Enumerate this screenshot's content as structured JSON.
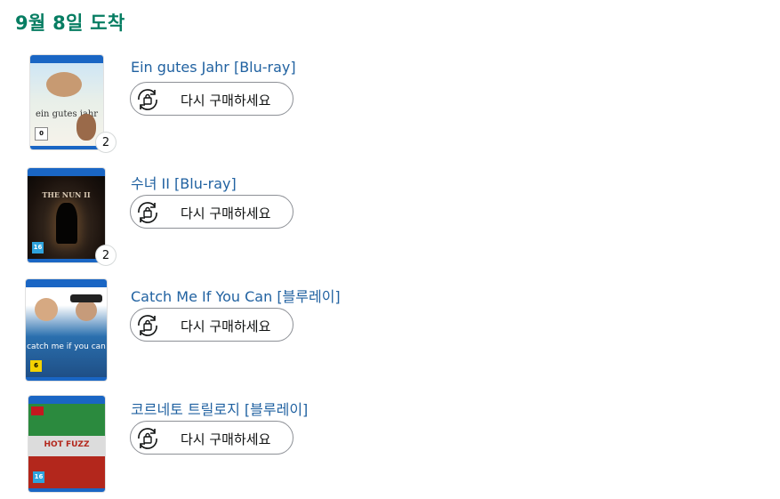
{
  "heading": "9월 8일 도착",
  "reorder_label": "다시 구매하세요",
  "items": [
    {
      "title": "Ein gutes Jahr [Blu-ray]",
      "quantity": "2",
      "cover_text": "ein gutes jahr",
      "age_rating": "0"
    },
    {
      "title": "수녀 II [Blu-ray]",
      "quantity": "2",
      "cover_text": "THE NUN II",
      "age_rating": "16"
    },
    {
      "title": "Catch Me If You Can [블루레이]",
      "quantity": "",
      "cover_text": "catch me if you can",
      "age_rating": "6"
    },
    {
      "title": "코르네토 트릴로지 [블루레이]",
      "quantity": "",
      "cover_text": "HOT FUZZ",
      "age_rating": "16"
    }
  ],
  "colors": {
    "heading": "#067d62",
    "link": "#2162a1",
    "button_border": "#8d9096",
    "bluray_band": "#1a66c4"
  },
  "icons": {
    "reorder": "repeat-shopping-bag-icon"
  }
}
